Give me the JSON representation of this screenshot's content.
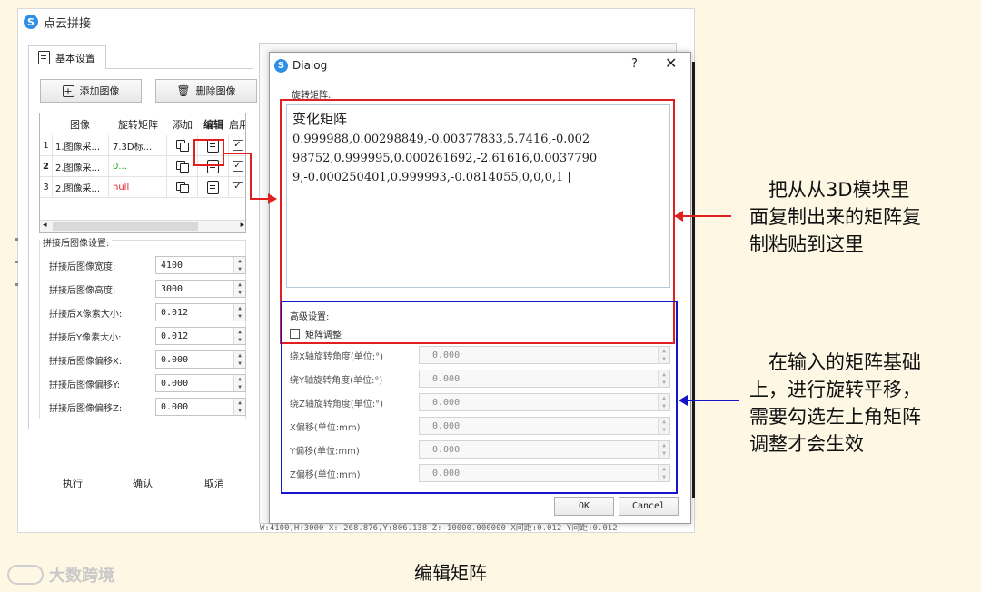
{
  "app": {
    "title": "点云拼接"
  },
  "tab": {
    "label": "基本设置"
  },
  "toolbar": {
    "add_label": "添加图像",
    "delete_label": "删除图像"
  },
  "table": {
    "headers": [
      "图像",
      "旋转矩阵",
      "添加",
      "编辑",
      "启用"
    ],
    "rows": [
      {
        "num": "1",
        "image": "1.图像采...",
        "matrix": "7.3D标...",
        "matrix_color": "#222222"
      },
      {
        "num": "2",
        "image": "2.图像采...",
        "matrix": "0...",
        "matrix_color": "#1aa81a"
      },
      {
        "num": "3",
        "image": "2.图像采...",
        "matrix": "null",
        "matrix_color": "#e02020"
      }
    ]
  },
  "settings": {
    "title": "拼接后图像设置:",
    "fields": [
      {
        "label": "拼接后图像宽度:",
        "value": "4100"
      },
      {
        "label": "拼接后图像高度:",
        "value": "3000"
      },
      {
        "label": "拼接后X像素大小:",
        "value": "0.012"
      },
      {
        "label": "拼接后Y像素大小:",
        "value": "0.012"
      },
      {
        "label": "拼接后图像偏移X:",
        "value": "0.000"
      },
      {
        "label": "拼接后图像偏移Y:",
        "value": "0.000"
      },
      {
        "label": "拼接后图像偏移Z:",
        "value": "0.000"
      }
    ]
  },
  "bottom_buttons": {
    "execute": "执行",
    "confirm": "确认",
    "cancel": "取消"
  },
  "status_line": "W:4100,H:3000 X:-268.876,Y:806.138 Z:-10000.000000 X间距:0.012 Y间距:0.012",
  "dialog": {
    "title": "Dialog",
    "help": "?",
    "close": "✕",
    "rotation_label": "旋转矩阵:",
    "matrix_title": "变化矩阵",
    "matrix_lines": [
      "0.999988,0.00298849,-0.00377833,5.7416,-0.002",
      "98752,0.999995,0.000261692,-2.61616,0.0037790",
      "9,-0.000250401,0.999993,-0.0814055,0,0,0,1 |"
    ],
    "advanced_title": "高级设置:",
    "matrix_adjust_label": "矩阵调整",
    "advanced_fields": [
      {
        "label": "绕X轴旋转角度(单位:°)",
        "value": "0.000"
      },
      {
        "label": "绕Y轴旋转角度(单位:°)",
        "value": "0.000"
      },
      {
        "label": "绕Z轴旋转角度(单位:°)",
        "value": "0.000"
      },
      {
        "label": "X偏移(单位:mm)",
        "value": "0.000"
      },
      {
        "label": "Y偏移(单位:mm)",
        "value": "0.000"
      },
      {
        "label": "Z偏移(单位:mm)",
        "value": "0.000"
      }
    ],
    "ok_label": "OK",
    "cancel_label": "Cancel"
  },
  "annotations": {
    "note1_lines": [
      "　把从从3D模块里",
      "面复制出来的矩阵复",
      "制粘贴到这里"
    ],
    "note2_lines": [
      "　在输入的矩阵基础",
      "上，进行旋转平移，",
      "需要勾选左上角矩阵",
      "调整才会生效"
    ],
    "caption": "编辑矩阵",
    "watermark": "大数跨境"
  },
  "colors": {
    "highlight_red": "#e02020",
    "highlight_blue": "#1414c8",
    "background": "#fdf7e3"
  }
}
